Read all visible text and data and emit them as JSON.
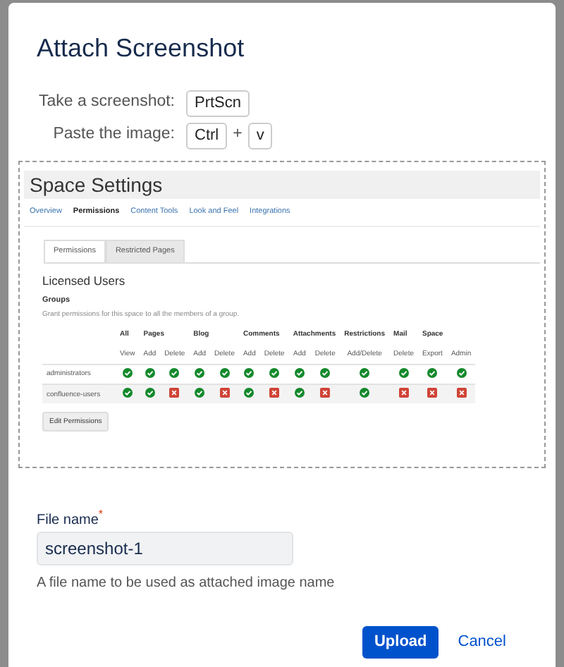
{
  "dialog": {
    "title": "Attach Screenshot",
    "shortcuts": [
      {
        "label": "Take a screenshot:",
        "keys": [
          "PrtScn"
        ]
      },
      {
        "label": "Paste the image:",
        "keys": [
          "Ctrl",
          "v"
        ],
        "joiner": "+"
      }
    ],
    "preview": {
      "title": "Space Settings",
      "nav": [
        {
          "label": "Overview",
          "selected": false
        },
        {
          "label": "Permissions",
          "selected": true
        },
        {
          "label": "Content Tools",
          "selected": false
        },
        {
          "label": "Look and Feel",
          "selected": false
        },
        {
          "label": "Integrations",
          "selected": false
        }
      ],
      "tabs": [
        {
          "label": "Permissions",
          "selected": true
        },
        {
          "label": "Restricted Pages",
          "selected": false
        }
      ],
      "heading": "Licensed Users",
      "subheading": "Groups",
      "description": "Grant permissions for this space to all the members of a group.",
      "column_groups": [
        {
          "label": "All",
          "columns": [
            "View"
          ]
        },
        {
          "label": "Pages",
          "columns": [
            "Add",
            "Delete"
          ]
        },
        {
          "label": "Blog",
          "columns": [
            "Add",
            "Delete"
          ]
        },
        {
          "label": "Comments",
          "columns": [
            "Add",
            "Delete"
          ]
        },
        {
          "label": "Attachments",
          "columns": [
            "Add",
            "Delete"
          ]
        },
        {
          "label": "Restrictions",
          "columns": [
            "Add/Delete"
          ]
        },
        {
          "label": "Mail",
          "columns": [
            "Delete"
          ]
        },
        {
          "label": "Space",
          "columns": [
            "Export",
            "Admin"
          ]
        }
      ],
      "rows": [
        {
          "group": "administrators",
          "permissions": [
            true,
            true,
            true,
            true,
            true,
            true,
            true,
            true,
            true,
            true,
            true,
            true,
            true
          ]
        },
        {
          "group": "confluence-users",
          "permissions": [
            true,
            true,
            false,
            true,
            false,
            true,
            false,
            true,
            false,
            true,
            false,
            false,
            false
          ]
        }
      ],
      "button": "Edit Permissions"
    },
    "file_name": {
      "label": "File name",
      "required_mark": "*",
      "value": "screenshot-1",
      "help": "A file name to be used as attached image name"
    },
    "buttons": [
      {
        "label": "Upload",
        "kind": "primary"
      },
      {
        "label": "Cancel",
        "kind": "link"
      }
    ]
  }
}
